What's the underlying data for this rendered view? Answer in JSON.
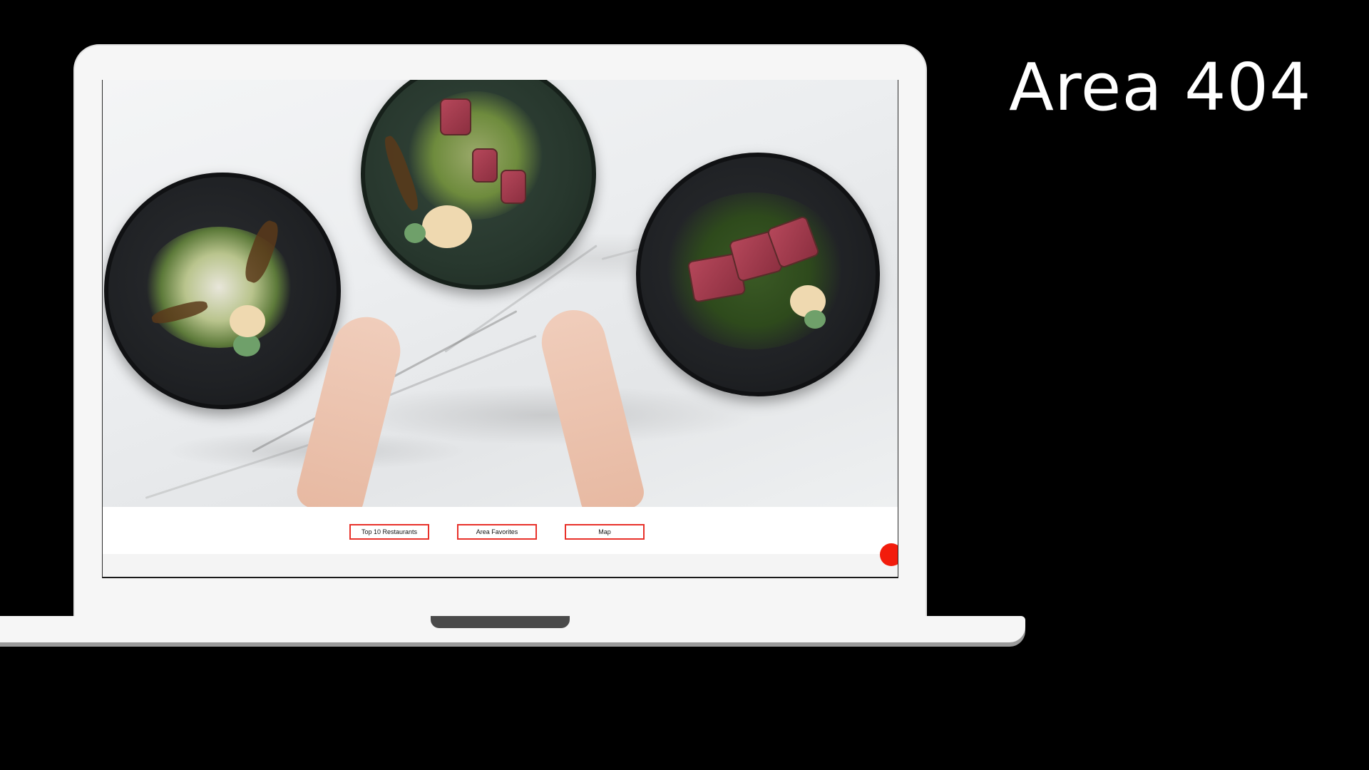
{
  "title": "Area 404",
  "website": {
    "hero_image": {
      "subject": "food-plates-on-marble"
    },
    "nav": {
      "buttons": [
        {
          "label": "Top 10 Restaurants"
        },
        {
          "label": "Area Favorites"
        },
        {
          "label": "Map"
        }
      ]
    },
    "chat_widget": {
      "icon": "chat-bubble-icon"
    }
  },
  "colors": {
    "background": "#000000",
    "accent": "#e8312a",
    "chat_button": "#f21c0c",
    "laptop_body": "#f6f6f6",
    "title_text": "#ffffff"
  }
}
